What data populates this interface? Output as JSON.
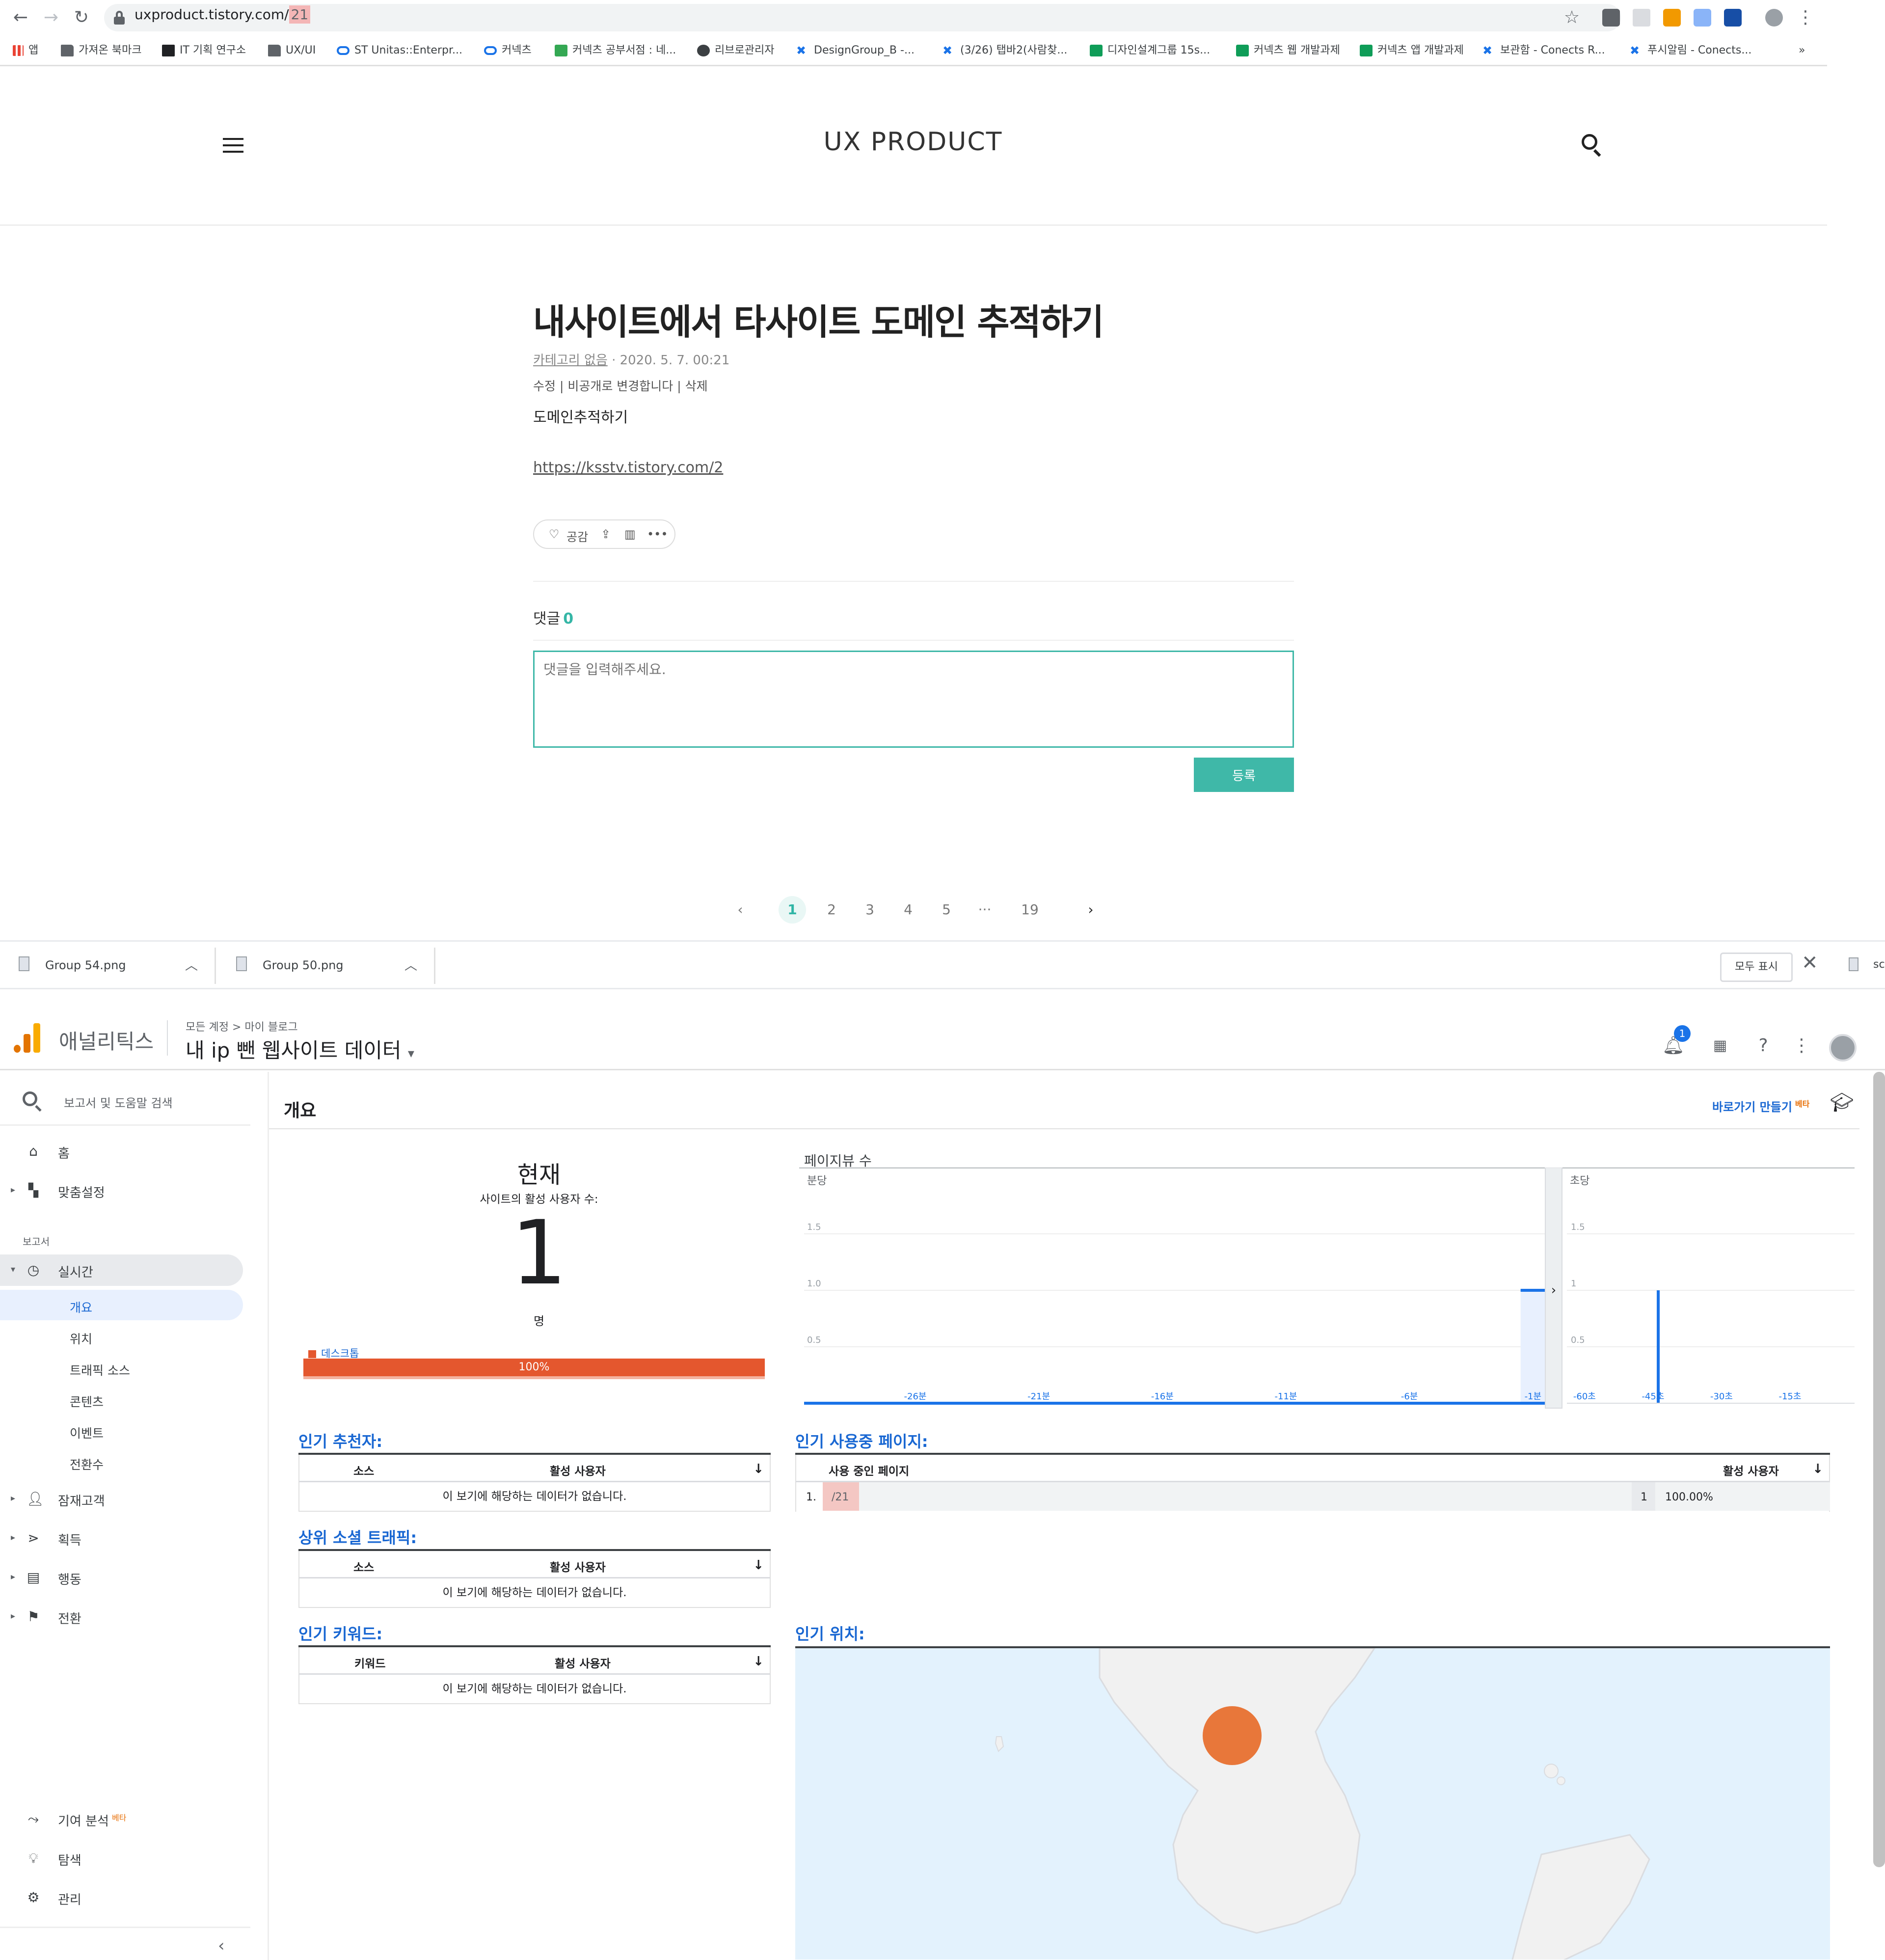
{
  "browser": {
    "url_host": "uxproduct.tistory.com/",
    "url_path": "21",
    "bookmarks": [
      {
        "label": "앱",
        "icon": "apps-grid-icon"
      },
      {
        "label": "가져온 북마크",
        "icon": "folder-icon"
      },
      {
        "label": "IT 기획 연구소",
        "icon": "bookmark-site-icon"
      },
      {
        "label": "UX/UI",
        "icon": "folder-icon"
      },
      {
        "label": "ST Unitas::Enterpr...",
        "icon": "infinity-icon"
      },
      {
        "label": "커넥츠",
        "icon": "infinity-icon"
      },
      {
        "label": "커넥츠 공부서점 : 네...",
        "icon": "bookstore-icon"
      },
      {
        "label": "리브로관리자",
        "icon": "globe-icon"
      },
      {
        "label": "DesignGroup_B -...",
        "icon": "confluence-icon"
      },
      {
        "label": "(3/26) 탭바2(사람찾...",
        "icon": "confluence-icon"
      },
      {
        "label": "디자인설계그룹 15s...",
        "icon": "sheets-icon"
      },
      {
        "label": "커넥츠 웹 개발과제",
        "icon": "sheets-icon"
      },
      {
        "label": "커넥츠 앱 개발과제",
        "icon": "sheets-icon"
      },
      {
        "label": "보관함 - Conects R...",
        "icon": "confluence-icon"
      },
      {
        "label": "푸시알림 - Conects...",
        "icon": "confluence-icon"
      }
    ],
    "bookmarks_overflow": "»"
  },
  "blog": {
    "site_title": "UX PRODUCT",
    "post_title": "내사이트에서 타사이트 도메인 추적하기",
    "category": "카테고리 없음",
    "date": "· 2020. 5. 7. 00:21",
    "admin_links": "수정 | 비공개로 변경합니다 | 삭제",
    "body_text": "도메인추적하기",
    "link": "https://ksstv.tistory.com/2",
    "like_label": "공감",
    "comment_label": "댓글",
    "comment_count": "0",
    "comment_placeholder": "댓글을 입력해주세요.",
    "submit_label": "등록",
    "pagination": {
      "prev": "‹",
      "pages": [
        "1",
        "2",
        "3",
        "4",
        "5",
        "···",
        "19"
      ],
      "current": "1",
      "next": "›"
    }
  },
  "downloads": {
    "items": [
      "Group 54.png",
      "Group 50.png"
    ],
    "show_all": "모두 표시",
    "partial_item": "sc"
  },
  "analytics": {
    "product": "애널리틱스",
    "breadcrumb": "모든 계정 > 마이 블로그",
    "property": "내 ip 뺀 웹사이트 데이터",
    "notification_count": "1",
    "sidebar": {
      "search_placeholder": "보고서 및 도움말 검색",
      "home": "홈",
      "custom": "맞춤설정",
      "reports_label": "보고서",
      "realtime": "실시간",
      "realtime_items": [
        "개요",
        "위치",
        "트래픽 소스",
        "콘텐츠",
        "이벤트",
        "전환수"
      ],
      "audience": "잠재고객",
      "acquisition": "획득",
      "behavior": "행동",
      "conversions": "전환",
      "attribution": "기여 분석",
      "attribution_beta": "베타",
      "discover": "탐색",
      "admin": "관리"
    },
    "overview_title": "개요",
    "shortcut_label": "바로가기 만들기",
    "shortcut_beta": "베타",
    "now": {
      "label": "현재",
      "sub": "사이트의 활성 사용자 수:",
      "value": "1",
      "unit": "명",
      "device_label": "데스크톱",
      "device_share": 100,
      "device_share_label": "100%"
    },
    "pageviews_title": "페이지뷰 수",
    "top_referrals": {
      "title": "인기 추천자:",
      "col1": "소스",
      "col2": "활성 사용자",
      "empty": "이 보기에 해당하는 데이터가 없습니다."
    },
    "top_social": {
      "title": "상위 소셜 트래픽:",
      "col1": "소스",
      "col2": "활성 사용자",
      "empty": "이 보기에 해당하는 데이터가 없습니다."
    },
    "top_keywords": {
      "title": "인기 키워드:",
      "col1": "키워드",
      "col2": "활성 사용자",
      "empty": "이 보기에 해당하는 데이터가 없습니다."
    },
    "top_pages": {
      "title": "인기 사용중 페이지:",
      "col1": "사용 중인 페이지",
      "col2": "활성 사용자",
      "rows": [
        {
          "rank": "1.",
          "page": "/21",
          "users": "1",
          "pct": "100.00%"
        }
      ]
    },
    "top_locations_title": "인기 위치:"
  },
  "chart_data": [
    {
      "type": "bar",
      "title": "페이지뷰 수",
      "ylabel": "분당",
      "x": [
        "-30분",
        "-29분",
        "-28분",
        "-27분",
        "-26분",
        "-25분",
        "-24분",
        "-23분",
        "-22분",
        "-21분",
        "-20분",
        "-19분",
        "-18분",
        "-17분",
        "-16분",
        "-15분",
        "-14분",
        "-13분",
        "-12분",
        "-11분",
        "-10분",
        "-9분",
        "-8분",
        "-7분",
        "-6분",
        "-5분",
        "-4분",
        "-3분",
        "-2분",
        "-1분"
      ],
      "xticks": [
        "-26분",
        "-21분",
        "-16분",
        "-11분",
        "-6분",
        "-1분"
      ],
      "values": [
        0,
        0,
        0,
        0,
        0,
        0,
        0,
        0,
        0,
        0,
        0,
        0,
        0,
        0,
        0,
        0,
        0,
        0,
        0,
        0,
        0,
        0,
        0,
        0,
        0,
        0,
        0,
        0,
        0,
        1
      ],
      "yticks": [
        "0.5",
        "1.0",
        "1.5"
      ],
      "ylim": [
        0,
        2
      ]
    },
    {
      "type": "bar",
      "ylabel": "초당",
      "x": [
        "-60초",
        "-45초",
        "-30초",
        "-15초"
      ],
      "xticks": [
        "-60초",
        "-45초",
        "-30초",
        "-15초"
      ],
      "spike_at_seconds": -43,
      "spike_value": 1,
      "yticks": [
        "0.5",
        "1",
        "1.5"
      ],
      "ylim": [
        0,
        2
      ]
    }
  ],
  "colors": {
    "accent_teal": "#3fb8a8",
    "ga_blue": "#1967d2",
    "desktop_orange": "#e4572e",
    "map_marker": "#e8773a"
  }
}
